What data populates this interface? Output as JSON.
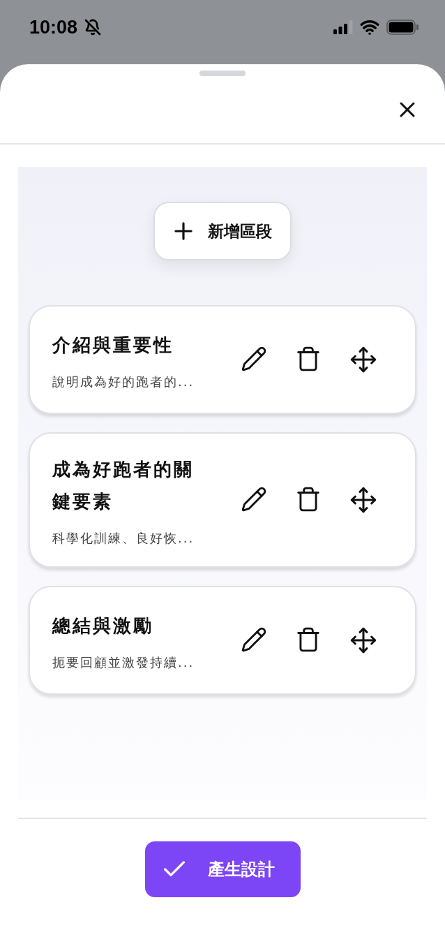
{
  "status_bar": {
    "time": "10:08",
    "muted": true
  },
  "add_section_button": {
    "label": "新增區段"
  },
  "sections": [
    {
      "title": "介紹與重要性",
      "summary": "說明成為好的跑者的..."
    },
    {
      "title": "成為好跑者的關鍵要素",
      "summary": "科學化訓練、良好恢..."
    },
    {
      "title": "總結與激勵",
      "summary": "扼要回顧並激發持續..."
    }
  ],
  "generate_button": {
    "label": "產生設計"
  }
}
